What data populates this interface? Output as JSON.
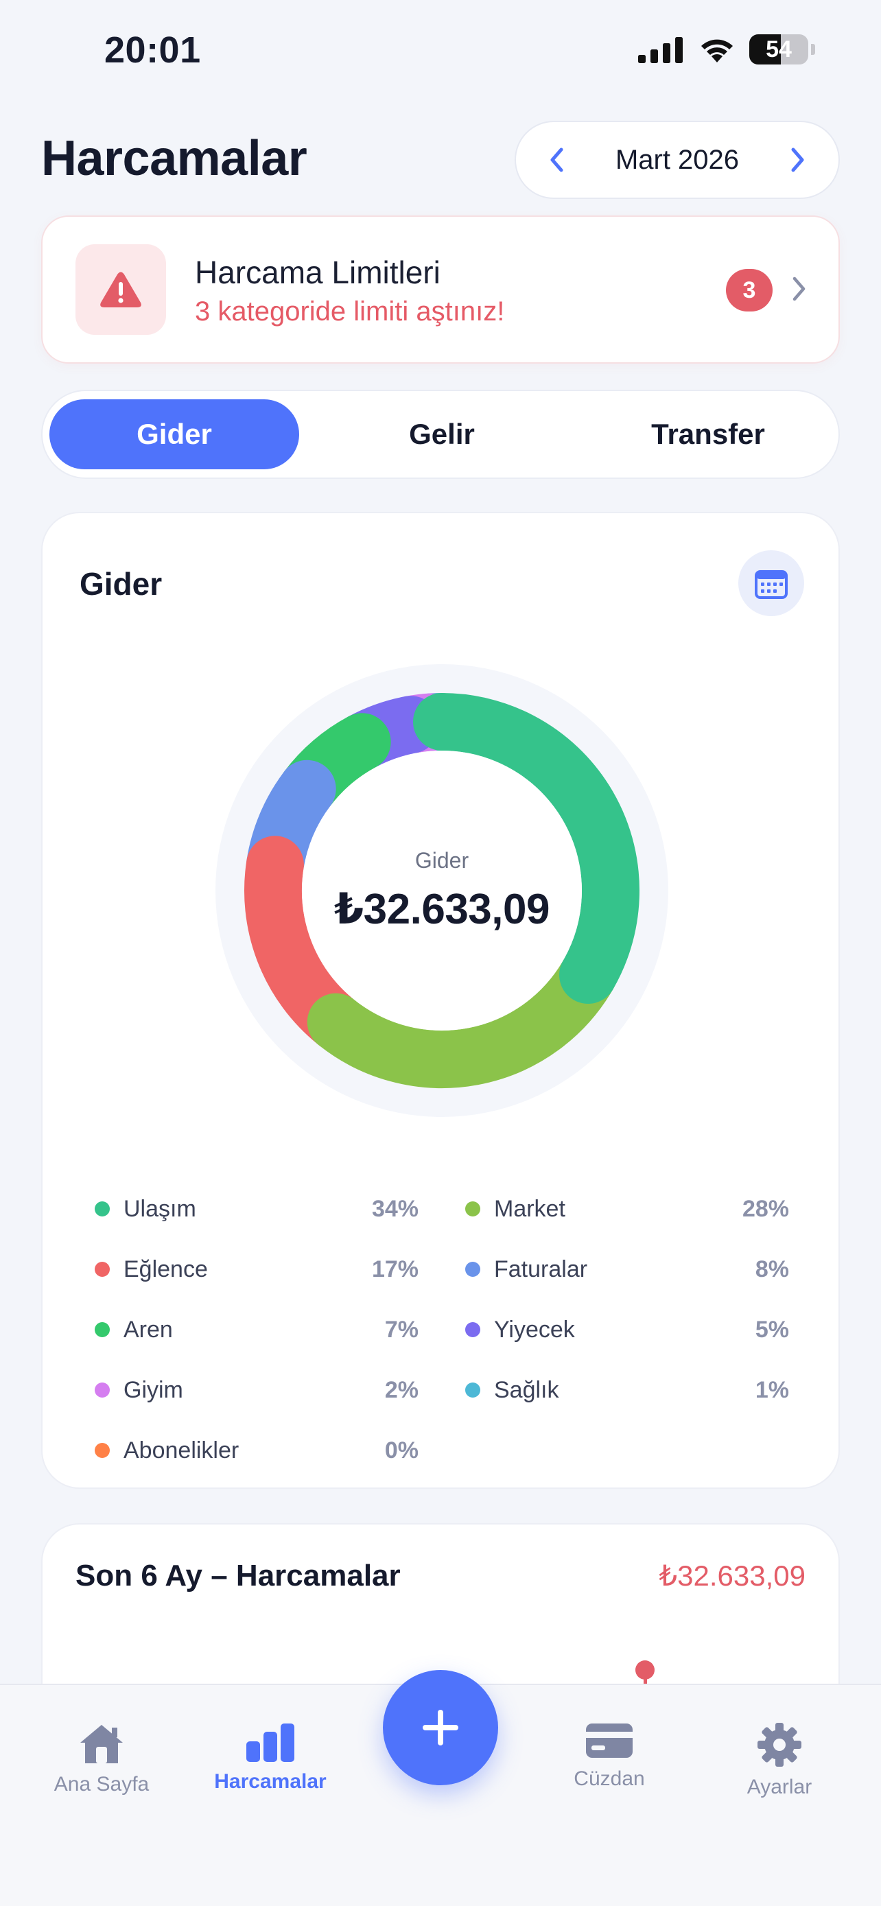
{
  "status_bar": {
    "time": "20:01",
    "battery": "54"
  },
  "header": {
    "title": "Harcamalar",
    "month": "Mart 2026"
  },
  "limit_card": {
    "title": "Harcama Limitleri",
    "subtitle": "3 kategoride limiti aştınız!",
    "badge": "3"
  },
  "tabs": {
    "gider": "Gider",
    "gelir": "Gelir",
    "transfer": "Transfer"
  },
  "chart_card": {
    "title": "Gider",
    "center_label": "Gider",
    "center_value": "₺32.633,09"
  },
  "chart_data": {
    "type": "pie",
    "categories": [
      "Ulaşım",
      "Market",
      "Eğlence",
      "Faturalar",
      "Aren",
      "Yiyecek",
      "Giyim",
      "Sağlık",
      "Abonelikler"
    ],
    "values": [
      34,
      28,
      17,
      8,
      7,
      5,
      2,
      1,
      0
    ],
    "labels": [
      "34%",
      "28%",
      "17%",
      "8%",
      "7%",
      "5%",
      "2%",
      "1%",
      "0%"
    ],
    "colors": [
      "#35c38b",
      "#8bc34a",
      "#f06565",
      "#6a93ea",
      "#34c96c",
      "#7b6cf0",
      "#d57ef0",
      "#4db8d6",
      "#ff8147"
    ],
    "donut": true,
    "legend": "bottom"
  },
  "trend_card": {
    "title": "Son 6 Ay – Harcamalar",
    "total": "₺32.633,09"
  },
  "tab_bar": {
    "home": "Ana Sayfa",
    "expenses": "Harcamalar",
    "wallet": "Cüzdan",
    "settings": "Ayarlar"
  }
}
